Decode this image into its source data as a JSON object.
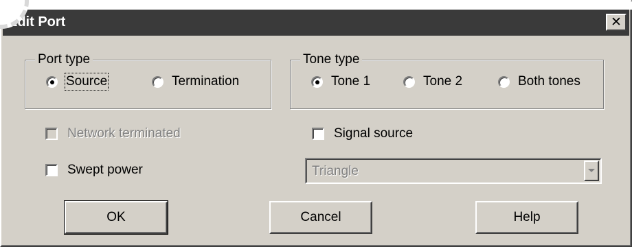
{
  "window": {
    "title": "Edit Port",
    "close_glyph": "✕"
  },
  "port_type": {
    "legend": "Port type",
    "options": [
      {
        "label": "Source",
        "selected": true
      },
      {
        "label": "Termination",
        "selected": false
      }
    ]
  },
  "tone_type": {
    "legend": "Tone type",
    "options": [
      {
        "label": "Tone 1",
        "selected": true
      },
      {
        "label": "Tone 2",
        "selected": false
      },
      {
        "label": "Both tones",
        "selected": false
      }
    ]
  },
  "checkboxes": {
    "network_terminated": {
      "label": "Network terminated",
      "checked": false,
      "enabled": false
    },
    "signal_source": {
      "label": "Signal source",
      "checked": false,
      "enabled": true
    },
    "swept_power": {
      "label": "Swept power",
      "checked": false,
      "enabled": true
    }
  },
  "waveform_select": {
    "value": "Triangle",
    "enabled": false
  },
  "buttons": {
    "ok": "OK",
    "cancel": "Cancel",
    "help": "Help"
  },
  "colors": {
    "dialog_face": "#d4d0c8",
    "titlebar": "#3a3a3a",
    "disabled_text": "#808080"
  }
}
